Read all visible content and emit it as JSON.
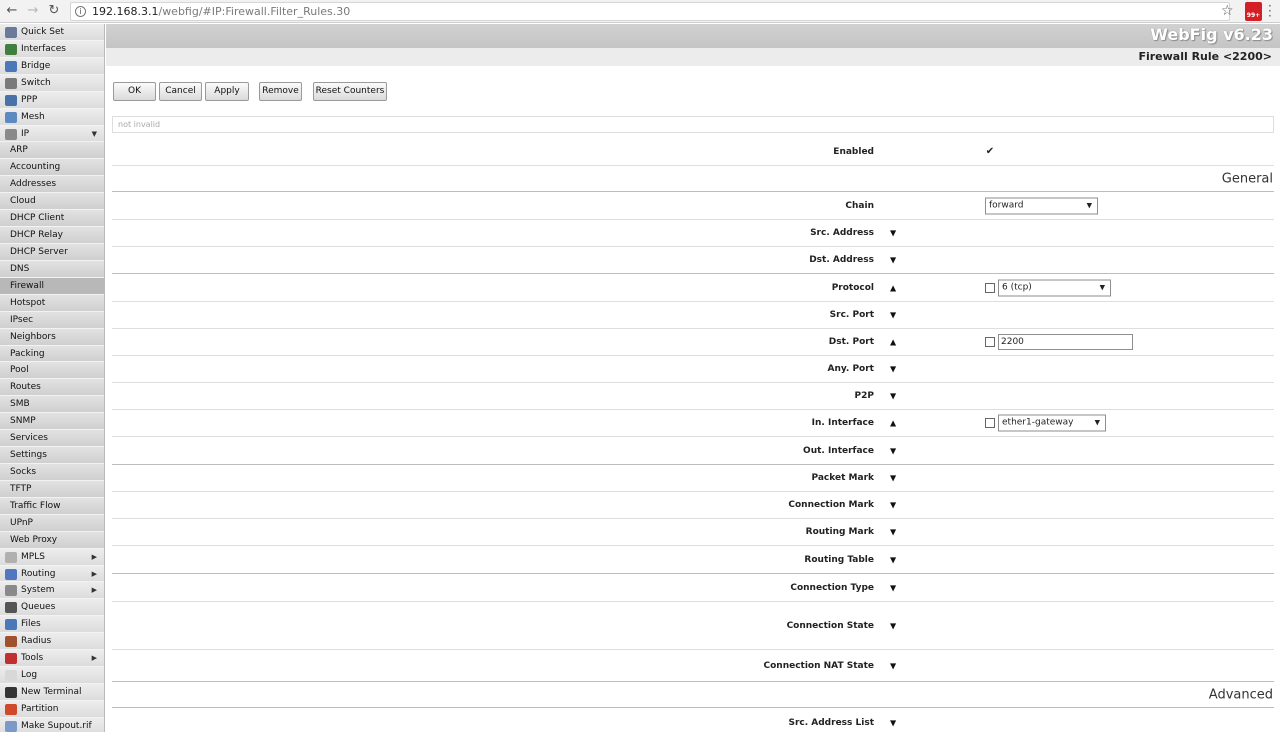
{
  "browser": {
    "url_host": "192.168.3.1",
    "url_path": "/webfig/#IP:Firewall.Filter_Rules.30",
    "extension_badge": "99+"
  },
  "sidebar": {
    "items": [
      {
        "label": "Quick Set",
        "icon": "wand-icon",
        "color": "#6a7a9a",
        "sub": false
      },
      {
        "label": "Interfaces",
        "icon": "interfaces-icon",
        "color": "#3f7f3f",
        "sub": false
      },
      {
        "label": "Bridge",
        "icon": "bridge-icon",
        "color": "#4a78b8",
        "sub": false
      },
      {
        "label": "Switch",
        "icon": "switch-icon",
        "color": "#7a7a7a",
        "sub": false
      },
      {
        "label": "PPP",
        "icon": "ppp-icon",
        "color": "#4a72aa",
        "sub": false
      },
      {
        "label": "Mesh",
        "icon": "mesh-icon",
        "color": "#5a8ac0",
        "sub": false
      },
      {
        "label": "IP",
        "icon": "ip-icon",
        "color": "#8a8a8a",
        "sub": false,
        "arrow": "▼"
      },
      {
        "label": "ARP",
        "sub": true
      },
      {
        "label": "Accounting",
        "sub": true
      },
      {
        "label": "Addresses",
        "sub": true
      },
      {
        "label": "Cloud",
        "sub": true
      },
      {
        "label": "DHCP Client",
        "sub": true
      },
      {
        "label": "DHCP Relay",
        "sub": true
      },
      {
        "label": "DHCP Server",
        "sub": true
      },
      {
        "label": "DNS",
        "sub": true
      },
      {
        "label": "Firewall",
        "sub": true,
        "active": true
      },
      {
        "label": "Hotspot",
        "sub": true
      },
      {
        "label": "IPsec",
        "sub": true
      },
      {
        "label": "Neighbors",
        "sub": true
      },
      {
        "label": "Packing",
        "sub": true
      },
      {
        "label": "Pool",
        "sub": true
      },
      {
        "label": "Routes",
        "sub": true
      },
      {
        "label": "SMB",
        "sub": true
      },
      {
        "label": "SNMP",
        "sub": true
      },
      {
        "label": "Services",
        "sub": true
      },
      {
        "label": "Settings",
        "sub": true
      },
      {
        "label": "Socks",
        "sub": true
      },
      {
        "label": "TFTP",
        "sub": true
      },
      {
        "label": "Traffic Flow",
        "sub": true
      },
      {
        "label": "UPnP",
        "sub": true
      },
      {
        "label": "Web Proxy",
        "sub": true
      },
      {
        "label": "MPLS",
        "icon": "mpls-icon",
        "color": "#b0b0b0",
        "sub": false,
        "arrow": "▶"
      },
      {
        "label": "Routing",
        "icon": "routing-icon",
        "color": "#5078c0",
        "sub": false,
        "arrow": "▶"
      },
      {
        "label": "System",
        "icon": "gear-icon",
        "color": "#8a8a8a",
        "sub": false,
        "arrow": "▶"
      },
      {
        "label": "Queues",
        "icon": "queues-icon",
        "color": "#555555",
        "sub": false
      },
      {
        "label": "Files",
        "icon": "files-icon",
        "color": "#4a78b8",
        "sub": false
      },
      {
        "label": "Radius",
        "icon": "radius-icon",
        "color": "#a0522d",
        "sub": false
      },
      {
        "label": "Tools",
        "icon": "tools-icon",
        "color": "#c03030",
        "sub": false,
        "arrow": "▶"
      },
      {
        "label": "Log",
        "icon": "log-icon",
        "color": "#d8d8d8",
        "sub": false
      },
      {
        "label": "New Terminal",
        "icon": "terminal-icon",
        "color": "#333333",
        "sub": false
      },
      {
        "label": "Partition",
        "icon": "partition-icon",
        "color": "#d04a2a",
        "sub": false
      },
      {
        "label": "Make Supout.rif",
        "icon": "supout-icon",
        "color": "#7a9ac8",
        "sub": false
      }
    ]
  },
  "header": {
    "product": "WebFig v6.23",
    "title": "Firewall Rule <2200>"
  },
  "toolbar": {
    "ok": "OK",
    "cancel": "Cancel",
    "apply": "Apply",
    "remove": "Remove",
    "reset_counters": "Reset Counters"
  },
  "status_line": "not invalid",
  "form": {
    "enabled_label": "Enabled",
    "enabled_checked": "✔",
    "section_general": "General",
    "chain_label": "Chain",
    "chain_value": "forward",
    "src_address_label": "Src. Address",
    "dst_address_label": "Dst. Address",
    "protocol_label": "Protocol",
    "protocol_value": "6 (tcp)",
    "src_port_label": "Src. Port",
    "dst_port_label": "Dst. Port",
    "dst_port_value": "2200",
    "any_port_label": "Any. Port",
    "p2p_label": "P2P",
    "in_interface_label": "In. Interface",
    "in_interface_value": "ether1-gateway",
    "out_interface_label": "Out. Interface",
    "packet_mark_label": "Packet Mark",
    "connection_mark_label": "Connection Mark",
    "routing_mark_label": "Routing Mark",
    "routing_table_label": "Routing Table",
    "connection_type_label": "Connection Type",
    "connection_state_label": "Connection State",
    "connection_nat_state_label": "Connection NAT State",
    "section_advanced": "Advanced",
    "src_address_list_label": "Src. Address List",
    "expand_glyph": "▼",
    "collapse_glyph": "▲",
    "dropdown_glyph": "▼"
  }
}
